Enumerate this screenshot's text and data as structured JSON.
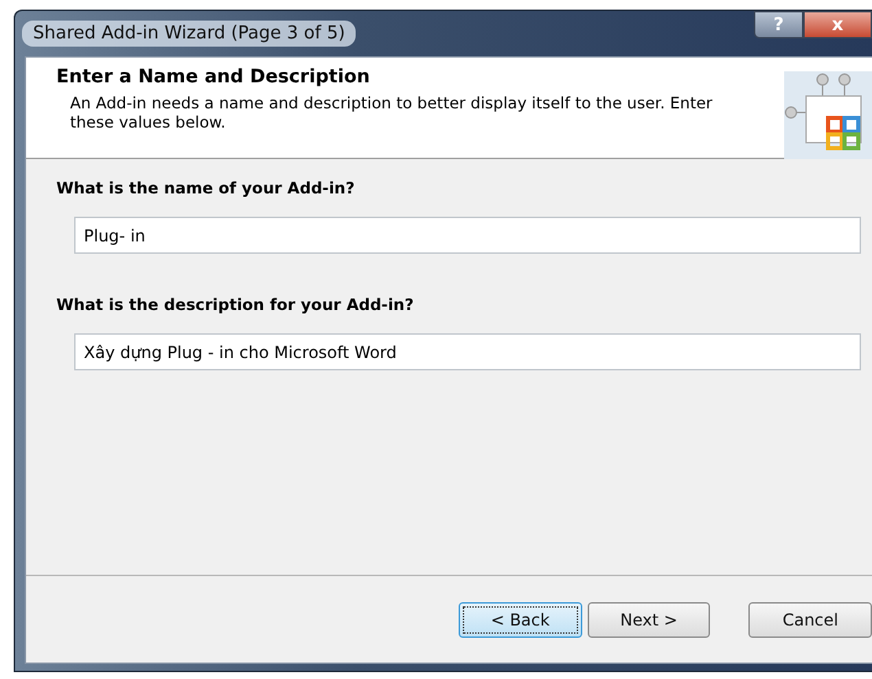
{
  "window": {
    "title": "Shared Add-in Wizard (Page 3 of 5)",
    "controls": [
      {
        "kind": "help",
        "label": "?"
      },
      {
        "kind": "close",
        "label": "x"
      }
    ]
  },
  "header": {
    "title": "Enter a Name and Description",
    "description": "An Add-in needs a name and description to better display itself to the user. Enter these values below."
  },
  "fields": [
    {
      "label": "What is the name of your Add-in?",
      "value": "Plug- in"
    },
    {
      "label": "What is the description for your Add-in?",
      "value": "Xây dựng Plug - in cho Microsoft Word"
    }
  ],
  "buttons": [
    {
      "label": "< Back",
      "focused": true
    },
    {
      "label": "Next >",
      "focused": false
    },
    {
      "label": "Cancel",
      "focused": false
    }
  ]
}
